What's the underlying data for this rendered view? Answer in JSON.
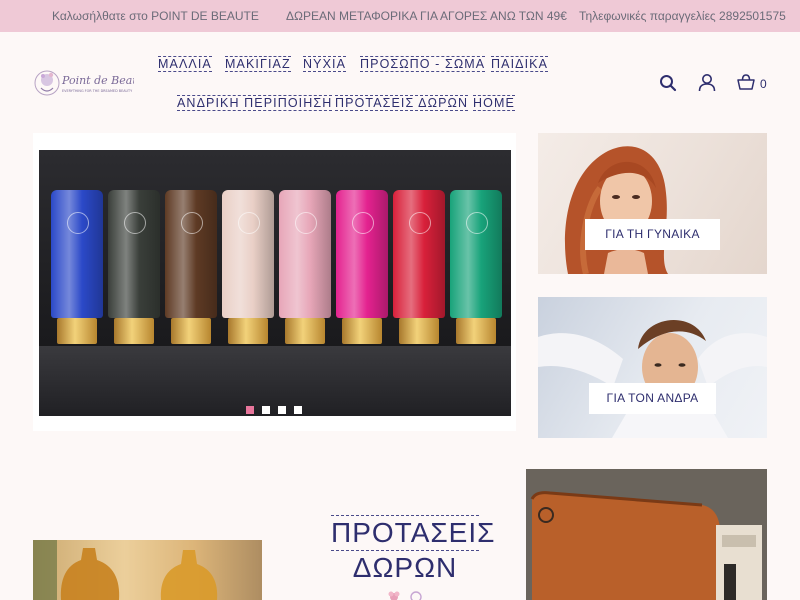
{
  "topbar": {
    "welcome": "Καλωσήλθατε στο POINT DE BEAUTE",
    "shipping": "ΔΩΡΕΑΝ ΜΕΤΑΦΟΡΙΚΑ ΓΙΑ ΑΓΟΡΕΣ ΑΝΩ ΤΩΝ 49€",
    "phone": "Τηλεφωνικές παραγγελίες 2892501575"
  },
  "logo": {
    "name": "Point de Beaute",
    "tagline": "EVERYTHING FOR THE DREAMED BEAUTY"
  },
  "nav": {
    "items": [
      "ΜΑΛΛΙΑ",
      "ΜΑΚΙΓΙΑΖ",
      "ΝΥΧΙΑ",
      "ΠΡΟΣΩΠΟ - ΣΩΜΑ",
      "ΠΑΙΔΙΚΑ",
      "ΑΝΔΡΙΚΗ ΠΕΡΙΠΟΙΗΣΗ",
      "ΠΡΟΤΑΣΕΙΣ ΔΩΡΩΝ",
      "HOME"
    ]
  },
  "header": {
    "cart_count": "0",
    "icons": [
      "search-icon",
      "user-icon",
      "basket-icon"
    ]
  },
  "hero": {
    "slide_count": 4,
    "active_slide": 1,
    "colors": {
      "active_dot": "#e8769c",
      "dot": "#ffffff"
    },
    "tube_colors": [
      "#2b49c8",
      "#3a3f3a",
      "#5e3a24",
      "#e9cfc6",
      "#e7a6b8",
      "#e4228f",
      "#d8203a",
      "#18a37a"
    ]
  },
  "banners": {
    "woman_label": "ΓΙΑ ΤΗ ΓΥΝΑΙΚΑ",
    "man_label": "ΓΙΑ ΤΟΝ ΑΝΔΡΑ"
  },
  "gifts": {
    "title_line1": "ΠΡΟΤΑΣΕΙΣ",
    "title_line2": "ΔΩΡΩΝ"
  },
  "colors": {
    "topbar_bg": "#efc9d6",
    "page_bg": "#fdf8f7",
    "text_primary": "#2e2e6e"
  }
}
